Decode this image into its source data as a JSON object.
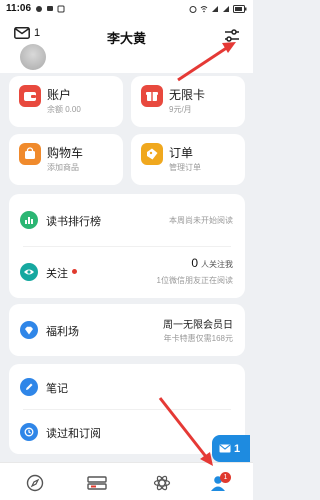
{
  "status_bar": {
    "time": "11:06"
  },
  "header": {
    "title": "李大黄",
    "mail_count": "1"
  },
  "tiles": {
    "account": {
      "title": "账户",
      "sub": "余额 0.00"
    },
    "unlimited": {
      "title": "无限卡",
      "sub": "9元/月"
    },
    "cart": {
      "title": "购物车",
      "sub": "添加商品"
    },
    "orders": {
      "title": "订单",
      "sub": "管理订单"
    }
  },
  "ranking": {
    "title": "读书排行榜",
    "right": "本周尚未开始阅读"
  },
  "follow": {
    "title": "关注",
    "count": "0",
    "count_suffix": "人关注我",
    "sub": "1位微信朋友正在阅读"
  },
  "welfare": {
    "title": "福利场",
    "right_main": "周一无限会员日",
    "right_sub": "年卡特惠仅需168元"
  },
  "notes": {
    "title": "笔记"
  },
  "history": {
    "title": "读过和订阅"
  },
  "float_message": {
    "count": "1"
  },
  "bottom_nav": {
    "profile_badge": "1"
  },
  "colors": {
    "accent_blue": "#1e8be0",
    "account_red": "#e8493e",
    "cart_orange": "#f08a2c",
    "order_yellow": "#f0a81e",
    "ranking_green": "#2bb673",
    "follow_teal": "#16a8a0",
    "welfare_blue": "#2f86e8",
    "notes_blue": "#2f86e8",
    "history_blue": "#2f86e8",
    "arrow_red": "#e53935"
  }
}
